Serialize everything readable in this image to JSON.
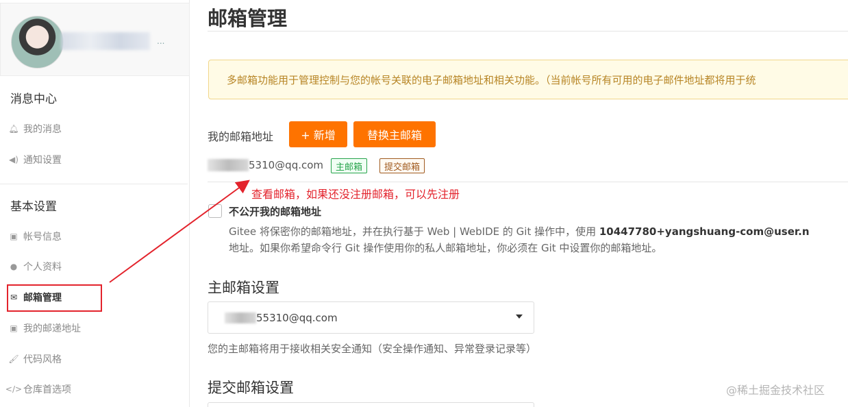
{
  "sidebar": {
    "profile": {
      "name_suffix": "..."
    },
    "sections": [
      {
        "title": "消息中心",
        "items": [
          {
            "label": "我的消息",
            "icon": "bell-icon"
          },
          {
            "label": "通知设置",
            "icon": "speaker-icon"
          }
        ]
      },
      {
        "title": "基本设置",
        "items": [
          {
            "label": "帐号信息",
            "icon": "id-card-icon"
          },
          {
            "label": "个人资料",
            "icon": "user-icon"
          },
          {
            "label": "邮箱管理",
            "icon": "envelope-icon",
            "active": true
          },
          {
            "label": "我的邮递地址",
            "icon": "id-card-icon"
          },
          {
            "label": "代码风格",
            "icon": "brush-icon"
          },
          {
            "label": "仓库首选项",
            "icon": "code-icon"
          }
        ]
      }
    ]
  },
  "main": {
    "title": "邮箱管理",
    "notice": "多邮箱功能用于管理控制与您的帐号关联的电子邮箱地址和相关功能。（当前帐号所有可用的电子邮件地址都将用于统",
    "email_label": "我的邮箱地址",
    "add_button": "+ 新增",
    "replace_button": "替换主邮箱",
    "email_visible": "5310@qq.com",
    "tag_primary": "主邮箱",
    "tag_commit": "提交邮箱",
    "annotation": "查看邮箱，如果还没注册邮箱，可以先注册",
    "private_checkbox_label": "不公开我的邮箱地址",
    "private_desc_1a": "Gitee 将保密你的邮箱地址，并在执行基于 Web | WebIDE 的 Git 操作中，使用 ",
    "private_desc_1b": "10447780+yangshuang-com@user.n",
    "private_desc_2": "地址。如果你希望命令行 Git 操作使用你的私人邮箱地址，你必须在 Git 中设置你的邮箱地址。",
    "primary_settings_title": "主邮箱设置",
    "primary_select_value": "55310@qq.com",
    "primary_help": "您的主邮箱将用于接收相关安全通知（安全操作通知、异常登录记录等）",
    "commit_settings_title": "提交邮箱设置"
  },
  "watermark": "@稀土掘金技术社区",
  "colors": {
    "accent": "#fe7300",
    "annotation_red": "#e3232c",
    "tag_green": "#26a34b",
    "tag_brown": "#a05a1e"
  }
}
